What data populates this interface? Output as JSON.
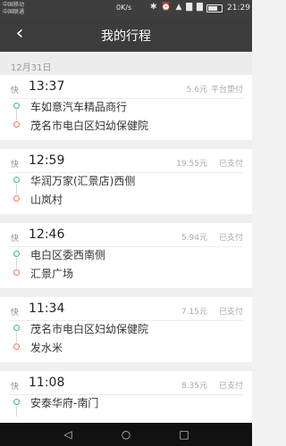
{
  "status_bar": {
    "carrier_line1": "中国移动",
    "carrier_line2": "中国联通",
    "speed": "0K/s",
    "icons": "✱ ⏰ ▲ ▇ ▇",
    "battery_level": 0.7,
    "time": "21:29"
  },
  "nav": {
    "back_icon": "back-arrow-icon",
    "title": "我的行程"
  },
  "date_header": "12月31日",
  "trips": [
    {
      "tag": "快",
      "time": "13:37",
      "price": "5.6元",
      "status": "平台垫付",
      "start": "车如意汽车精品商行",
      "end": "茂名市电白区妇幼保健院"
    },
    {
      "tag": "快",
      "time": "12:59",
      "price": "19.55元",
      "status": "已支付",
      "start": "华润万家(汇景店)西侧",
      "end": "山岚村"
    },
    {
      "tag": "快",
      "time": "12:46",
      "price": "5.94元",
      "status": "已支付",
      "start": "电白区委西南侧",
      "end": "汇景广场"
    },
    {
      "tag": "快",
      "time": "11:34",
      "price": "7.15元",
      "status": "已支付",
      "start": "茂名市电白区妇幼保健院",
      "end": "发水米"
    },
    {
      "tag": "快",
      "time": "11:08",
      "price": "8.35元",
      "status": "已支付",
      "start": "安泰华府-南门",
      "end": ""
    }
  ],
  "bottom_nav": {
    "back": "◁",
    "home": "○",
    "recent": "□"
  }
}
